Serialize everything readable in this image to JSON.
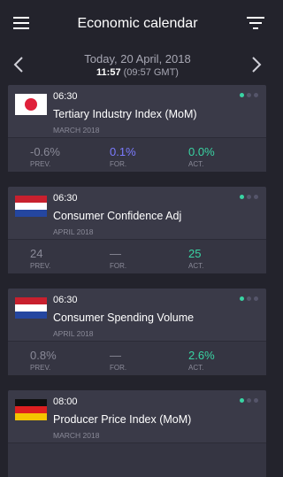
{
  "header": {
    "title": "Economic calendar",
    "menu_icon": "hamburger-menu-icon",
    "filter_icon": "filter-icon"
  },
  "date_nav": {
    "date_text": "Today, 20 April, 2018",
    "time_bold": "11:57",
    "time_gmt": " (09:57 GMT)",
    "prev_icon": "chevron-left-icon",
    "next_icon": "chevron-right-icon"
  },
  "labels": {
    "prev": "PREV.",
    "for": "FOR.",
    "act": "ACT."
  },
  "colors": {
    "background": "#23232c",
    "card": "#3a3a48",
    "forecast": "#7b7bff",
    "actual": "#39d4a3",
    "neutral": "#8a8a98"
  },
  "events": [
    {
      "time": "06:30",
      "title": "Tertiary Industry Index (MoM)",
      "period": "MARCH 2018",
      "flag": "japan-flag",
      "prev": "-0.6%",
      "forecast": "0.1%",
      "actual": "0.0%"
    },
    {
      "time": "06:30",
      "title": "Consumer Confidence Adj",
      "period": "APRIL 2018",
      "flag": "netherlands-flag",
      "prev": "24",
      "forecast": "—",
      "actual": "25"
    },
    {
      "time": "06:30",
      "title": "Consumer Spending Volume",
      "period": "APRIL 2018",
      "flag": "netherlands-flag",
      "prev": "0.8%",
      "forecast": "—",
      "actual": "2.6%"
    },
    {
      "time": "08:00",
      "title": "Producer Price Index (MoM)",
      "period": "MARCH 2018",
      "flag": "germany-flag",
      "prev": "",
      "forecast": "",
      "actual": ""
    }
  ]
}
